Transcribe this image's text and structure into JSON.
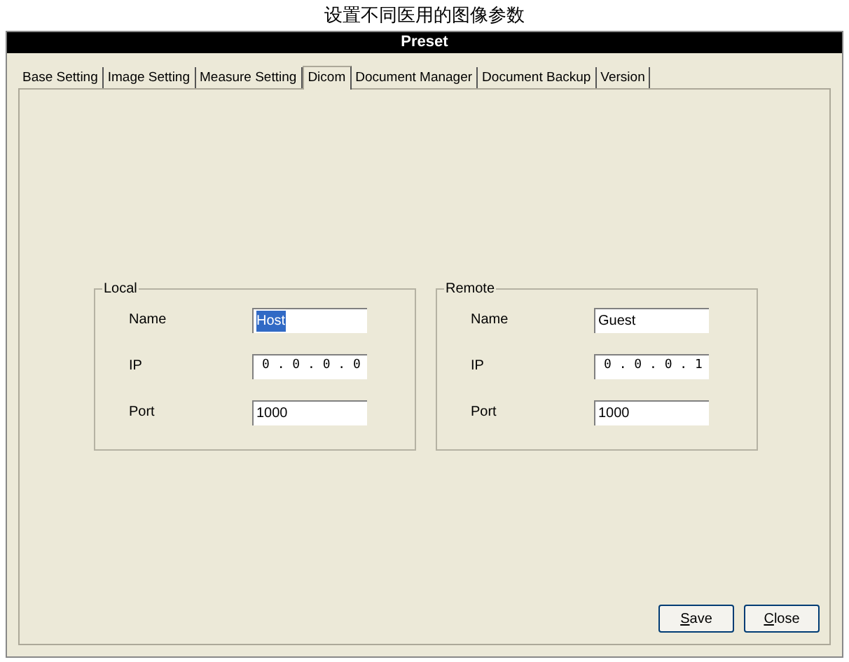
{
  "caption": "设置不同医用的图像参数",
  "window": {
    "title": "Preset"
  },
  "tabs": [
    {
      "label": "Base Setting",
      "selected": false
    },
    {
      "label": "Image Setting",
      "selected": false
    },
    {
      "label": "Measure Setting",
      "selected": false
    },
    {
      "label": "Dicom",
      "selected": true
    },
    {
      "label": "Document Manager",
      "selected": false
    },
    {
      "label": "Document Backup",
      "selected": false
    },
    {
      "label": "Version",
      "selected": false
    }
  ],
  "groups": [
    {
      "title": "Local",
      "fields": [
        {
          "label": "Name",
          "kind": "text",
          "value": "Host",
          "highlighted": true
        },
        {
          "label": "IP",
          "kind": "ip",
          "value": "0 . 0 . 0 . 0",
          "highlighted": false
        },
        {
          "label": "Port",
          "kind": "text",
          "value": "1000",
          "highlighted": false
        }
      ]
    },
    {
      "title": "Remote",
      "fields": [
        {
          "label": "Name",
          "kind": "text",
          "value": "Guest",
          "highlighted": false
        },
        {
          "label": "IP",
          "kind": "ip",
          "value": "0 . 0 . 0 . 1",
          "highlighted": false
        },
        {
          "label": "Port",
          "kind": "text",
          "value": "1000",
          "highlighted": false
        }
      ]
    }
  ],
  "buttons": [
    {
      "label": "Save"
    },
    {
      "label": "Close"
    }
  ]
}
